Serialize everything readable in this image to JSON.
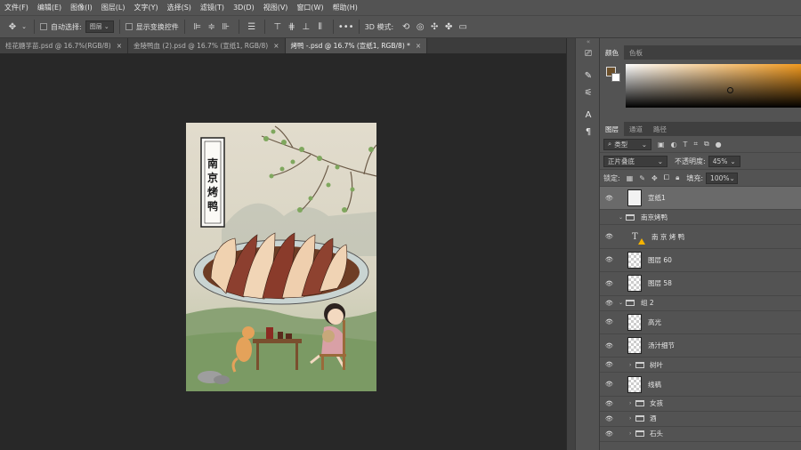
{
  "menu": [
    "文件(F)",
    "编辑(E)",
    "图像(I)",
    "图层(L)",
    "文字(Y)",
    "选择(S)",
    "滤镜(T)",
    "3D(D)",
    "视图(V)",
    "窗口(W)",
    "帮助(H)"
  ],
  "options": {
    "auto_select_label": "自动选择:",
    "auto_select_value": "图层",
    "show_transform_label": "显示变换控件",
    "mode_3d_label": "3D 模式:",
    "more": "•••"
  },
  "tabs": [
    {
      "label": "桂花糖芋苗.psd @ 16.7%(RGB/8)",
      "close": "×"
    },
    {
      "label": "金陵鸭血 (2).psd @ 16.7% (宣纸1, RGB/8)",
      "close": "×"
    },
    {
      "label": "烤鸭 -.psd @ 16.7% (宣纸1, RGB/8) *",
      "close": "×"
    }
  ],
  "artwork": {
    "title_chars": [
      "南",
      "京",
      "烤",
      "鸭"
    ]
  },
  "color_panel": {
    "tabs": [
      "颜色",
      "色板"
    ],
    "foreground": "#6b4f2a",
    "background": "#ffffff",
    "hue_color": "#f29a1f"
  },
  "layers_panel": {
    "tabs": [
      "图层",
      "通道",
      "路径"
    ],
    "filter_kind": "类型",
    "blend_mode": "正片叠底",
    "opacity_label": "不透明度:",
    "opacity_value": "45%",
    "lock_label": "锁定:",
    "fill_label": "填充:",
    "fill_value": "100%",
    "layers": [
      {
        "name": "宣纸1",
        "type": "plain",
        "selected": true
      },
      {
        "name": "南京烤鸭",
        "type": "group-open"
      },
      {
        "name": "南 京 烤 鸭",
        "type": "text"
      },
      {
        "name": "图层 60",
        "type": "pixel"
      },
      {
        "name": "图层 58",
        "type": "pixel"
      },
      {
        "name": "组 2",
        "type": "group-open"
      },
      {
        "name": "高光",
        "type": "pixel"
      },
      {
        "name": "汤汁细节",
        "type": "pixel"
      },
      {
        "name": "树叶",
        "type": "group"
      },
      {
        "name": "线稿",
        "type": "pixel"
      },
      {
        "name": "女孩",
        "type": "group"
      },
      {
        "name": "酒",
        "type": "group"
      },
      {
        "name": "石头",
        "type": "group"
      }
    ]
  }
}
